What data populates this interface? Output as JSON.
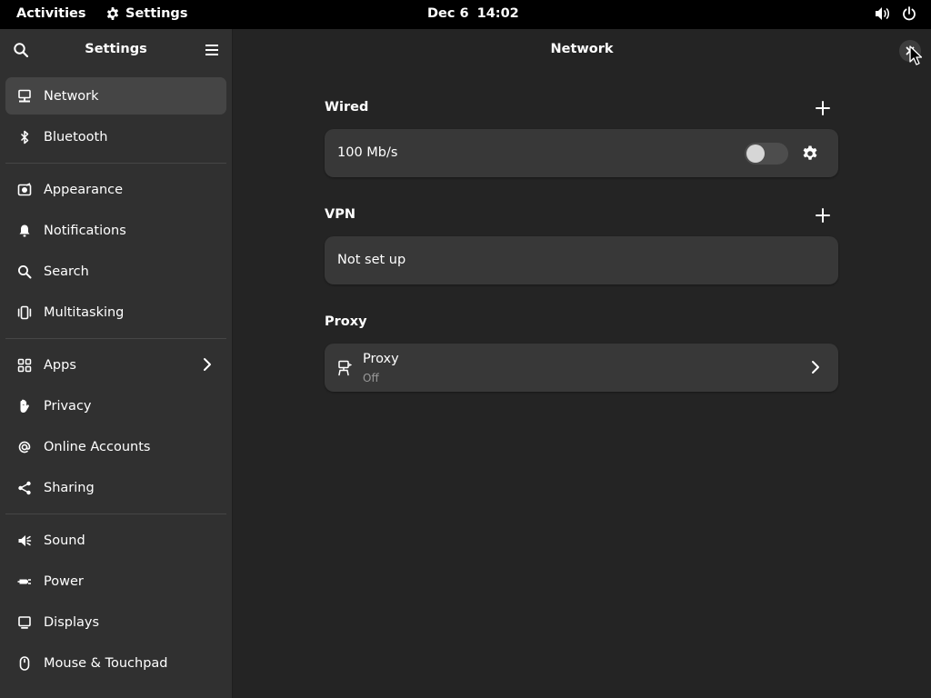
{
  "topbar": {
    "activities": "Activities",
    "app_name": "Settings",
    "date": "Dec 6",
    "time": "14:02",
    "app_icon": "gear-icon",
    "tray_icons": [
      "volume-icon",
      "power-icon"
    ]
  },
  "sidebar": {
    "title": "Settings",
    "search_icon": "search-icon",
    "menu_icon": "hamburger-menu-icon",
    "items": [
      {
        "label": "Network",
        "icon": "network-icon",
        "active": true
      },
      {
        "label": "Bluetooth",
        "icon": "bluetooth-icon"
      },
      {
        "label": "Appearance",
        "icon": "appearance-icon"
      },
      {
        "label": "Notifications",
        "icon": "bell-icon"
      },
      {
        "label": "Search",
        "icon": "search-icon"
      },
      {
        "label": "Multitasking",
        "icon": "multitasking-icon"
      },
      {
        "label": "Apps",
        "icon": "apps-grid-icon",
        "has_submenu": true
      },
      {
        "label": "Privacy",
        "icon": "hand-icon"
      },
      {
        "label": "Online Accounts",
        "icon": "at-icon"
      },
      {
        "label": "Sharing",
        "icon": "share-icon"
      },
      {
        "label": "Sound",
        "icon": "speaker-icon"
      },
      {
        "label": "Power",
        "icon": "plug-icon"
      },
      {
        "label": "Displays",
        "icon": "display-icon"
      },
      {
        "label": "Mouse & Touchpad",
        "icon": "mouse-icon"
      }
    ]
  },
  "main": {
    "title": "Network",
    "sections": {
      "wired": {
        "title": "Wired",
        "speed": "100 Mb/s",
        "toggle_on": false
      },
      "vpn": {
        "title": "VPN",
        "status": "Not set up"
      },
      "proxy": {
        "title": "Proxy",
        "row_title": "Proxy",
        "row_subtitle": "Off"
      }
    }
  },
  "colors": {
    "topbar_bg": "#000000",
    "sidebar_bg": "#303030",
    "main_bg": "#242424",
    "card_bg": "#383838",
    "active_item_bg": "#454545"
  }
}
